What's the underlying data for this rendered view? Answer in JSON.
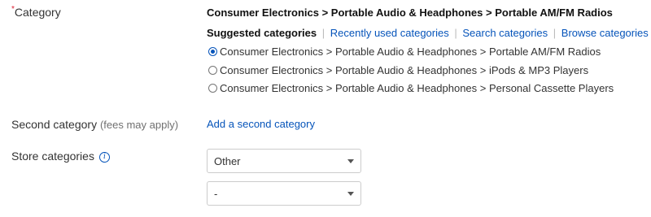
{
  "category": {
    "required_mark": "*",
    "label": "Category",
    "selected_path": "Consumer Electronics > Portable Audio & Headphones > Portable AM/FM Radios",
    "tabs": [
      {
        "label": "Suggested categories",
        "active": true
      },
      {
        "label": "Recently used categories",
        "active": false
      },
      {
        "label": "Search categories",
        "active": false
      },
      {
        "label": "Browse categories",
        "active": false
      }
    ],
    "options": [
      {
        "label": "Consumer Electronics > Portable Audio & Headphones > Portable AM/FM Radios",
        "checked": true
      },
      {
        "label": "Consumer Electronics > Portable Audio & Headphones > iPods & MP3 Players",
        "checked": false
      },
      {
        "label": "Consumer Electronics > Portable Audio & Headphones > Personal Cassette Players",
        "checked": false
      }
    ]
  },
  "second_category": {
    "label": "Second category",
    "note": "(fees may apply)",
    "link": "Add a second category"
  },
  "store_categories": {
    "label": "Store categories",
    "info_icon": "info-icon",
    "select_1": "Other",
    "select_2": "-"
  },
  "colors": {
    "link": "#0654ba",
    "required": "#dd1e31"
  }
}
